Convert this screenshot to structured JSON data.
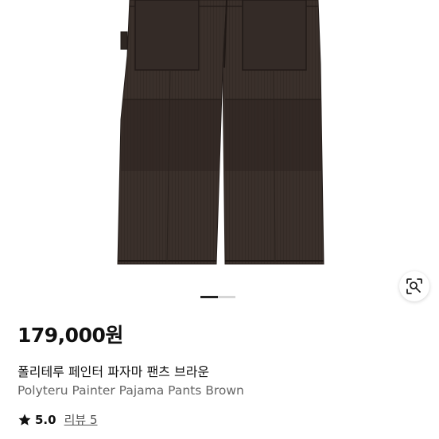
{
  "product": {
    "price": "179,000원",
    "title_ko": "폴리테루 페인터 파자마 팬츠 브라운",
    "title_en": "Polyteru Painter Pajama Pants Brown",
    "rating": "5.0",
    "review_label": "리뷰 5"
  },
  "gallery": {
    "image_alt": "Polyteru Painter Pajama Pants Brown",
    "current_page": 1,
    "total_pages": 2
  },
  "colors": {
    "pants": "#3a302b",
    "pants_shadow": "#2a221e",
    "accent_text": "#111111"
  },
  "icons": {
    "lens": "visual-search-icon",
    "star": "star-icon"
  }
}
